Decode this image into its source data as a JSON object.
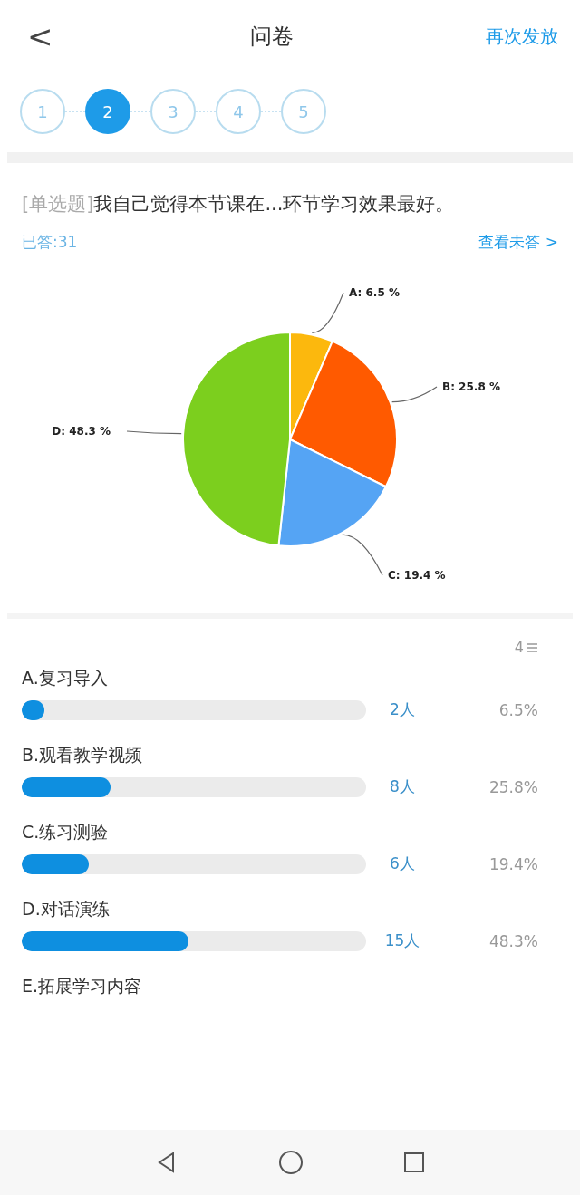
{
  "header": {
    "back": "<",
    "title": "问卷",
    "action": "再次发放"
  },
  "steps": [
    {
      "label": "1",
      "selected": false
    },
    {
      "label": "2",
      "selected": true
    },
    {
      "label": "3",
      "selected": false
    },
    {
      "label": "4",
      "selected": false
    },
    {
      "label": "5",
      "selected": false
    }
  ],
  "question": {
    "type": "[单选题]",
    "text": "我自己觉得本节课在...环节学习效果最好。"
  },
  "answered": "已答:31",
  "unanswered_link": "查看未答 >",
  "chart_data": {
    "type": "pie",
    "values": [
      6.5,
      25.8,
      19.4,
      48.3
    ],
    "colors": [
      "#fcb80d",
      "#ff5a00",
      "#55a4f4",
      "#7ccf1e"
    ],
    "value_labels": [
      "A: 6.5 %",
      "B: 25.8 %",
      "C: 19.4 %",
      "D: 48.3 %"
    ]
  },
  "count_label": "4",
  "options": [
    {
      "label": "A.复习导入",
      "level": 0.065,
      "count": "2人",
      "percent": "6.5%"
    },
    {
      "label": "B.观看教学视频",
      "level": 0.258,
      "count": "8人",
      "percent": "25.8%"
    },
    {
      "label": "C.练习测验",
      "level": 0.194,
      "count": "6人",
      "percent": "19.4%"
    },
    {
      "label": "D.对话演练",
      "level": 0.483,
      "count": "15人",
      "percent": "48.3%"
    },
    {
      "label": "E.拓展学习内容"
    }
  ]
}
